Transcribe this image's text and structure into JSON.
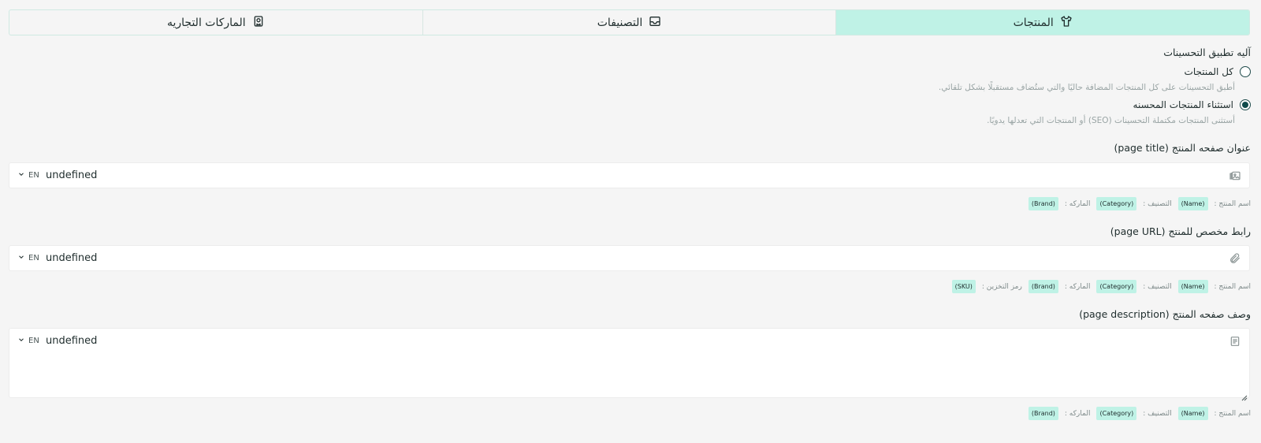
{
  "tabs": [
    {
      "label": "المنتجات",
      "icon": "shirt-icon",
      "active": true
    },
    {
      "label": "التصنيفات",
      "icon": "inbox-icon",
      "active": false
    },
    {
      "label": "الماركات التجاريه",
      "icon": "badge-icon",
      "active": false
    }
  ],
  "mechanism": {
    "title": "آليه تطبيق التحسينات",
    "options": [
      {
        "label": "كل المنتجات",
        "help": "أطبق التحسينات على كل المنتجات المضافة حاليًا والتي ستُضاف مستقبلًا بشكل تلقائي.",
        "checked": false
      },
      {
        "label": "استثناء المنتجات المحسنه",
        "help": "أستثنى المنتجات مكتملة التحسينات (SEO) أو المنتجات التي تعدلها يدويًا.",
        "checked": true
      }
    ]
  },
  "fields": [
    {
      "title": "عنوان صفحه المنتج (page title)",
      "value": "undefined",
      "lang": "EN",
      "icon": "image-gallery-icon",
      "chips": [
        {
          "label": "اسم المنتج :",
          "tag": "(Name)"
        },
        {
          "label": "التصنيف :",
          "tag": "(Category)"
        },
        {
          "label": "الماركه :",
          "tag": "(Brand)"
        }
      ]
    },
    {
      "title": "رابط مخصص للمنتج (page URL)",
      "value": "undefined",
      "lang": "EN",
      "icon": "paperclip-icon",
      "chips": [
        {
          "label": "اسم المنتج :",
          "tag": "(Name)"
        },
        {
          "label": "التصنيف :",
          "tag": "(Category)"
        },
        {
          "label": "الماركه :",
          "tag": "(Brand)"
        },
        {
          "label": "رمز التخزين :",
          "tag": "(SKU)"
        }
      ]
    },
    {
      "title": "وصف صفحه المنتج (page description)",
      "value": "undefined",
      "lang": "EN",
      "icon": "document-icon",
      "chips": [
        {
          "label": "اسم المنتج :",
          "tag": "(Name)"
        },
        {
          "label": "التصنيف :",
          "tag": "(Category)"
        },
        {
          "label": "الماركه :",
          "tag": "(Brand)"
        }
      ]
    }
  ],
  "colors": {
    "accent": "#bff2e6",
    "background": "#f5f5f5",
    "text": "#1f2d2d"
  }
}
